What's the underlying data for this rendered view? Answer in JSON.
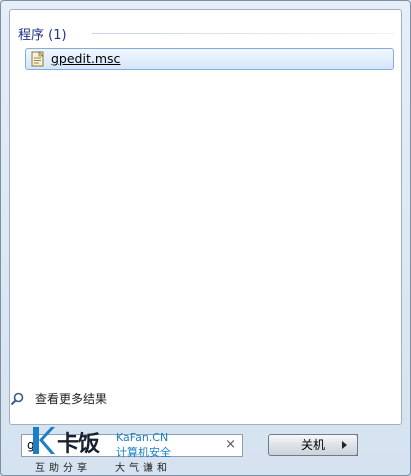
{
  "results": {
    "section_title": "程序 (1)",
    "items": [
      {
        "label": "gpedit.msc",
        "icon": "msc-file-icon"
      }
    ]
  },
  "more_results": {
    "label": "查看更多结果",
    "icon": "search-magnifier-icon"
  },
  "search": {
    "value": "g",
    "clear_icon": "×"
  },
  "shutdown": {
    "label": "关机",
    "arrow_icon": "chevron-right-icon"
  },
  "watermark": {
    "logo_text": "卡饭",
    "site": "KaFan.CN",
    "category": "计算机安全",
    "slogan_left": "互助分享",
    "slogan_right": "大气谦和"
  }
}
